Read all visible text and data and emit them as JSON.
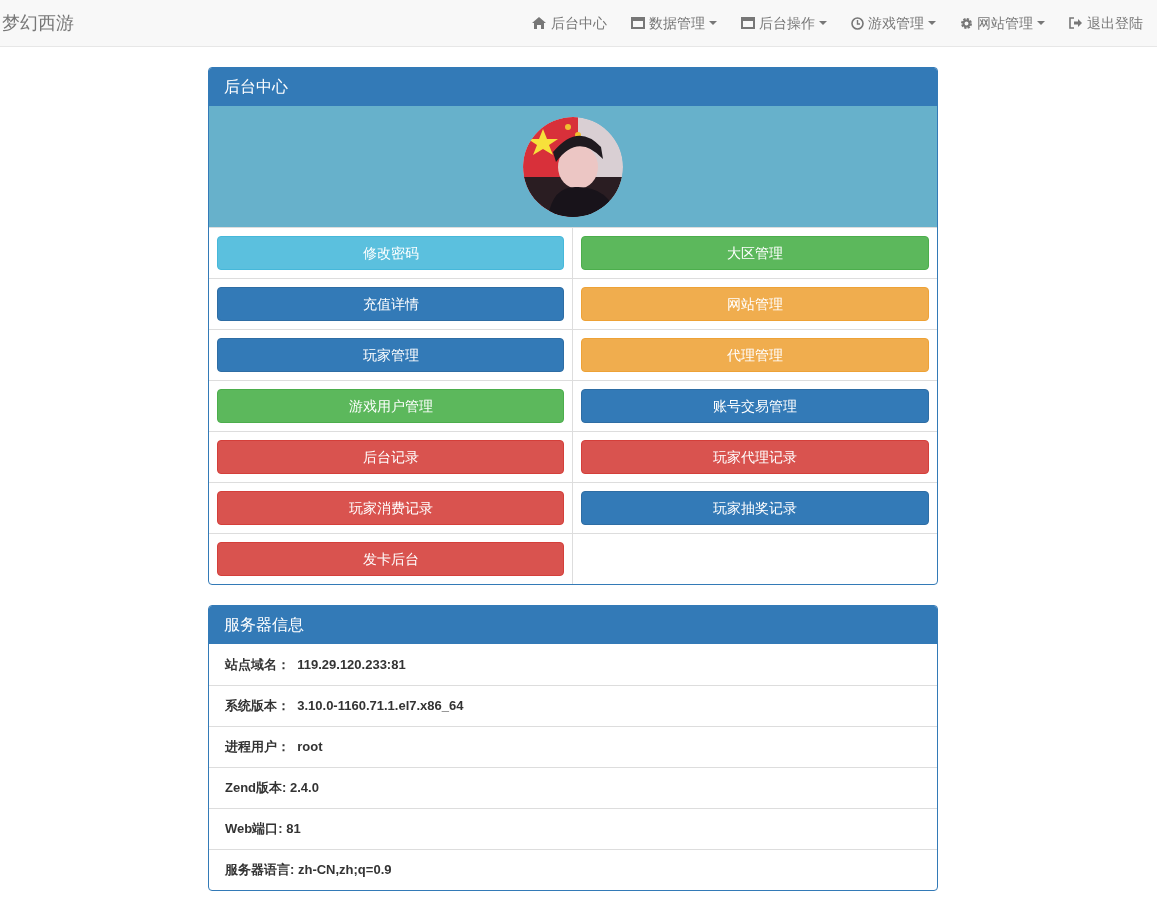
{
  "navbar": {
    "brand": "梦幻西游",
    "items": [
      {
        "label": "后台中心",
        "dropdown": false
      },
      {
        "label": "数据管理",
        "dropdown": true
      },
      {
        "label": "后台操作",
        "dropdown": true
      },
      {
        "label": "游戏管理",
        "dropdown": true
      },
      {
        "label": "网站管理",
        "dropdown": true
      },
      {
        "label": "退出登陆",
        "dropdown": false
      }
    ]
  },
  "admin_panel": {
    "title": "后台中心",
    "buttons": [
      {
        "label": "修改密码",
        "kind": "info"
      },
      {
        "label": "大区管理",
        "kind": "success"
      },
      {
        "label": "充值详情",
        "kind": "primary"
      },
      {
        "label": "网站管理",
        "kind": "warning"
      },
      {
        "label": "玩家管理",
        "kind": "primary"
      },
      {
        "label": "代理管理",
        "kind": "warning"
      },
      {
        "label": "游戏用户管理",
        "kind": "success"
      },
      {
        "label": "账号交易管理",
        "kind": "primary"
      },
      {
        "label": "后台记录",
        "kind": "danger"
      },
      {
        "label": "玩家代理记录",
        "kind": "danger"
      },
      {
        "label": "玩家消费记录",
        "kind": "danger"
      },
      {
        "label": "玩家抽奖记录",
        "kind": "primary"
      },
      {
        "label": "发卡后台",
        "kind": "danger"
      }
    ]
  },
  "server_panel": {
    "title": "服务器信息",
    "rows": [
      "站点域名：  119.29.120.233:81",
      "系统版本：  3.10.0-1160.71.1.el7.x86_64",
      "进程用户：  root",
      "Zend版本: 2.4.0",
      "Web端口: 81",
      "服务器语言: zh-CN,zh;q=0.9"
    ]
  }
}
